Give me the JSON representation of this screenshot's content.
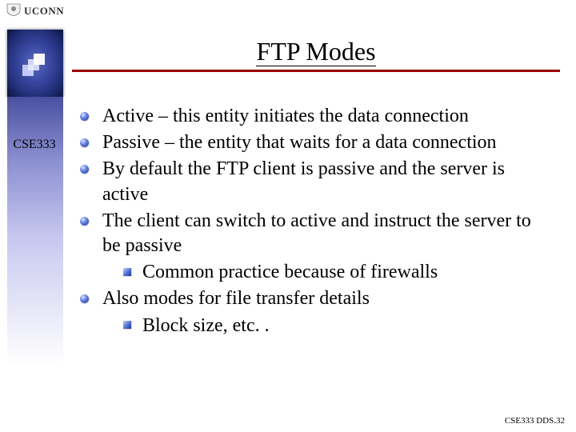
{
  "header": {
    "institution": "UCONN",
    "title": "FTP Modes"
  },
  "sidebar": {
    "course": "CSE333"
  },
  "bullets": [
    {
      "text": "Active – this entity initiates the data connection",
      "sub": []
    },
    {
      "text": "Passive – the entity that waits for a data connection",
      "sub": []
    },
    {
      "text": "By default the FTP client is passive and the server is active",
      "sub": []
    },
    {
      "text": "The client can switch to active and instruct the server to be passive",
      "sub": [
        "Common practice because of firewalls"
      ]
    },
    {
      "text": "Also modes for file transfer details",
      "sub": [
        "Block size, etc. ."
      ]
    }
  ],
  "footer": "CSE333 DDS.32"
}
